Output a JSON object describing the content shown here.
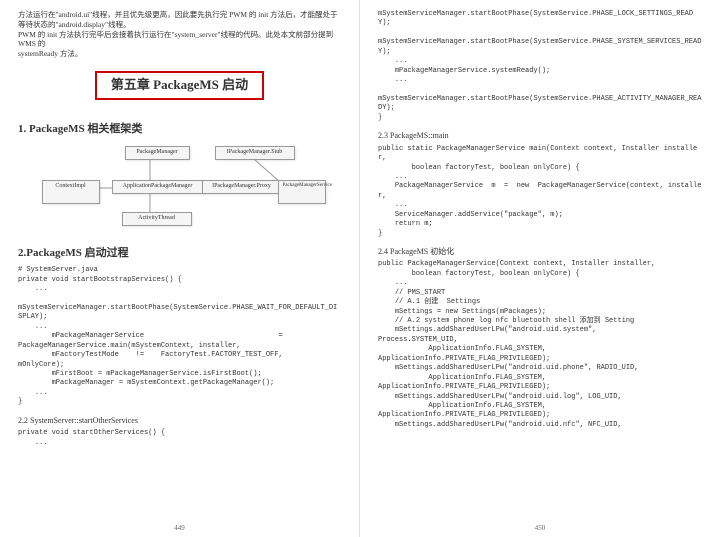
{
  "intro": {
    "p1": "方法运行在\"android.ui\"线程，并且优先级更高，因此要先执行完 PWM 的 init 方法后，才能醒处于等待状态的\"android.display\"线程。",
    "p2": "PWM 的 init 方法执行完毕后会接着执行运行在\"system_server\"线程的代码。此处本文前部分提到 WMS 的",
    "p3": "systemReady 方法。"
  },
  "chapter_title": "第五章 PackageMS 启动",
  "sec1_title": "1. PackageMS 相关框架类",
  "diagram": {
    "b1": "PackageManager",
    "b2": "IPackageManager.Stub",
    "b3": "ContextImpl",
    "b4": "ApplicationPackageManager",
    "b5": "IPackageManager.Proxy",
    "b6": "PackageManagerService",
    "b7": "ActivityThread"
  },
  "sec2_title": "2.PackageMS 启动过程",
  "code1": "# SystemServer.java\nprivate void startBootstrapServices() {\n    ...\n\nmSystemServiceManager.startBootPhase(SystemService.PHASE_WAIT_FOR_DEFAULT_DISPLAY);\n    ...\n        mPackageManagerService                                = \nPackageManagerService.main(mSystemContext, installer,\n        mFactoryTestMode    !=    FactoryTest.FACTORY_TEST_OFF, \nmOnlyCore);\n        mFirstBoot = mPackageManagerService.isFirstBoot();\n        mPackageManager = mSystemContext.getPackageManager();\n    ...\n}",
  "sub22": "2.2 SystemServer::startOtherServices",
  "code2": "private void startOtherServices() {\n    ...",
  "pgnum_left": "449",
  "code3": "mSystemServiceManager.startBootPhase(SystemService.PHASE_LOCK_SETTINGS_READY);\n\nmSystemServiceManager.startBootPhase(SystemService.PHASE_SYSTEM_SERVICES_READY);\n    ...\n    mPackageManagerService.systemReady();\n    ...\n\nmSystemServiceManager.startBootPhase(SystemService.PHASE_ACTIVITY_MANAGER_READY);\n}",
  "sub23": "2.3 PackageMS::main",
  "code4": "public static PackageManagerService main(Context context, Installer installer,\n        boolean factoryTest, boolean onlyCore) {\n    ...\n    PackageManagerService  m  =  new  PackageManagerService(context, installer,\n    ...\n    ServiceManager.addService(\"package\", m);\n    return m;\n}",
  "sub24": "2.4 PackageMS 初始化",
  "code5": "public PackageManagerService(Context context, Installer installer,\n        boolean factoryTest, boolean onlyCore) {\n    ...\n    // PMS_START\n    // A.1 创建  Settings\n    mSettings = new Settings(mPackages);\n    // A.2 system phone log nfc bluetooth shell 添加到 Setting\n    mSettings.addSharedUserLPw(\"android.uid.system\", \nProcess.SYSTEM_UID,\n            ApplicationInfo.FLAG_SYSTEM, \nApplicationInfo.PRIVATE_FLAG_PRIVILEGED);\n    mSettings.addSharedUserLPw(\"android.uid.phone\", RADIO_UID,\n            ApplicationInfo.FLAG_SYSTEM, \nApplicationInfo.PRIVATE_FLAG_PRIVILEGED);\n    mSettings.addSharedUserLPw(\"android.uid.log\", LOG_UID,\n            ApplicationInfo.FLAG_SYSTEM, \nApplicationInfo.PRIVATE_FLAG_PRIVILEGED);\n    mSettings.addSharedUserLPw(\"android.uid.nfc\", NFC_UID,",
  "pgnum_right": "450"
}
